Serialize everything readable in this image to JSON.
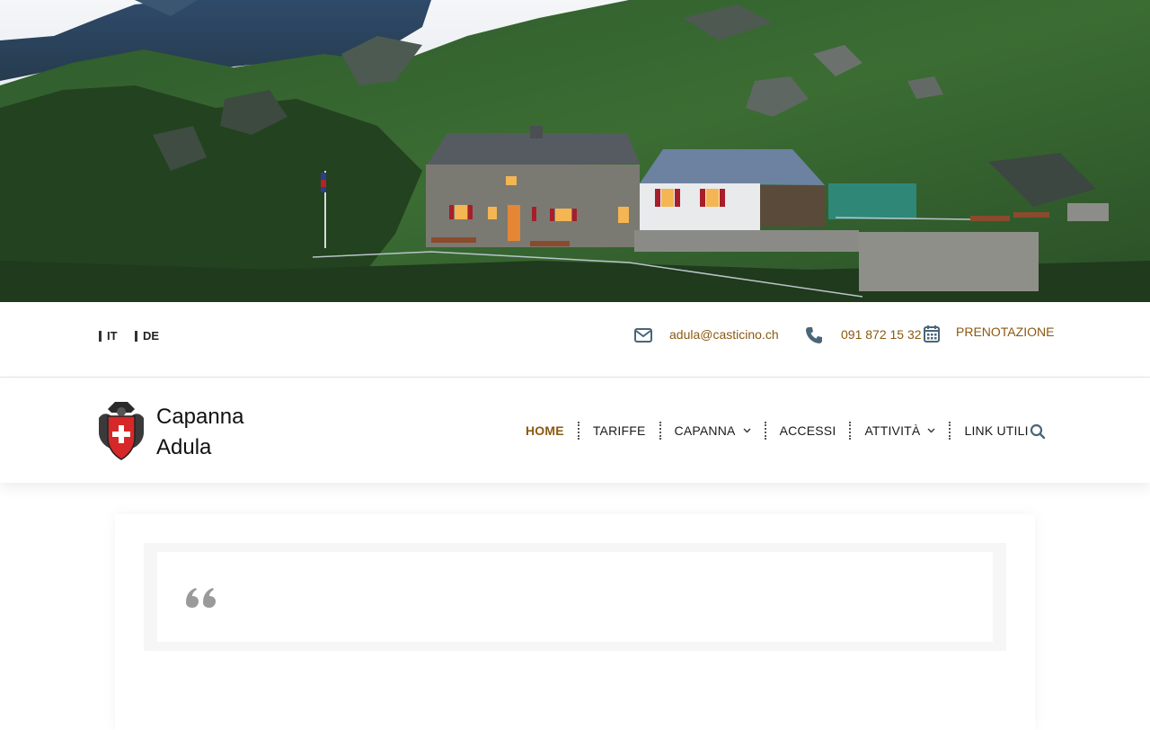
{
  "hero": {
    "image_icon": "mountain-hut-photo"
  },
  "topbar": {
    "languages": [
      "IT",
      "DE"
    ],
    "email": "adula@casticino.ch",
    "phone": "091 872 15 32",
    "booking": "PRENOTAZIONE",
    "icons": {
      "email": "envelope-icon",
      "phone": "phone-icon",
      "booking": "calendar-icon"
    }
  },
  "header": {
    "logo_line1": "Capanna",
    "logo_line2": "Adula",
    "logo_icon": "cas-emblem-icon",
    "nav": [
      {
        "label": "HOME",
        "active": true
      },
      {
        "label": "TARIFFE"
      },
      {
        "label": "CAPANNA",
        "dropdown": true
      },
      {
        "label": "ACCESSI"
      },
      {
        "label": "ATTIVITÀ",
        "dropdown": true
      },
      {
        "label": "LINK UTILI"
      }
    ],
    "search_icon": "search-icon"
  },
  "content": {
    "quote_icon": "quote-icon"
  },
  "colors": {
    "accent": "#8a5a10",
    "icon": "#4a6678",
    "text": "#1a1a1a"
  }
}
